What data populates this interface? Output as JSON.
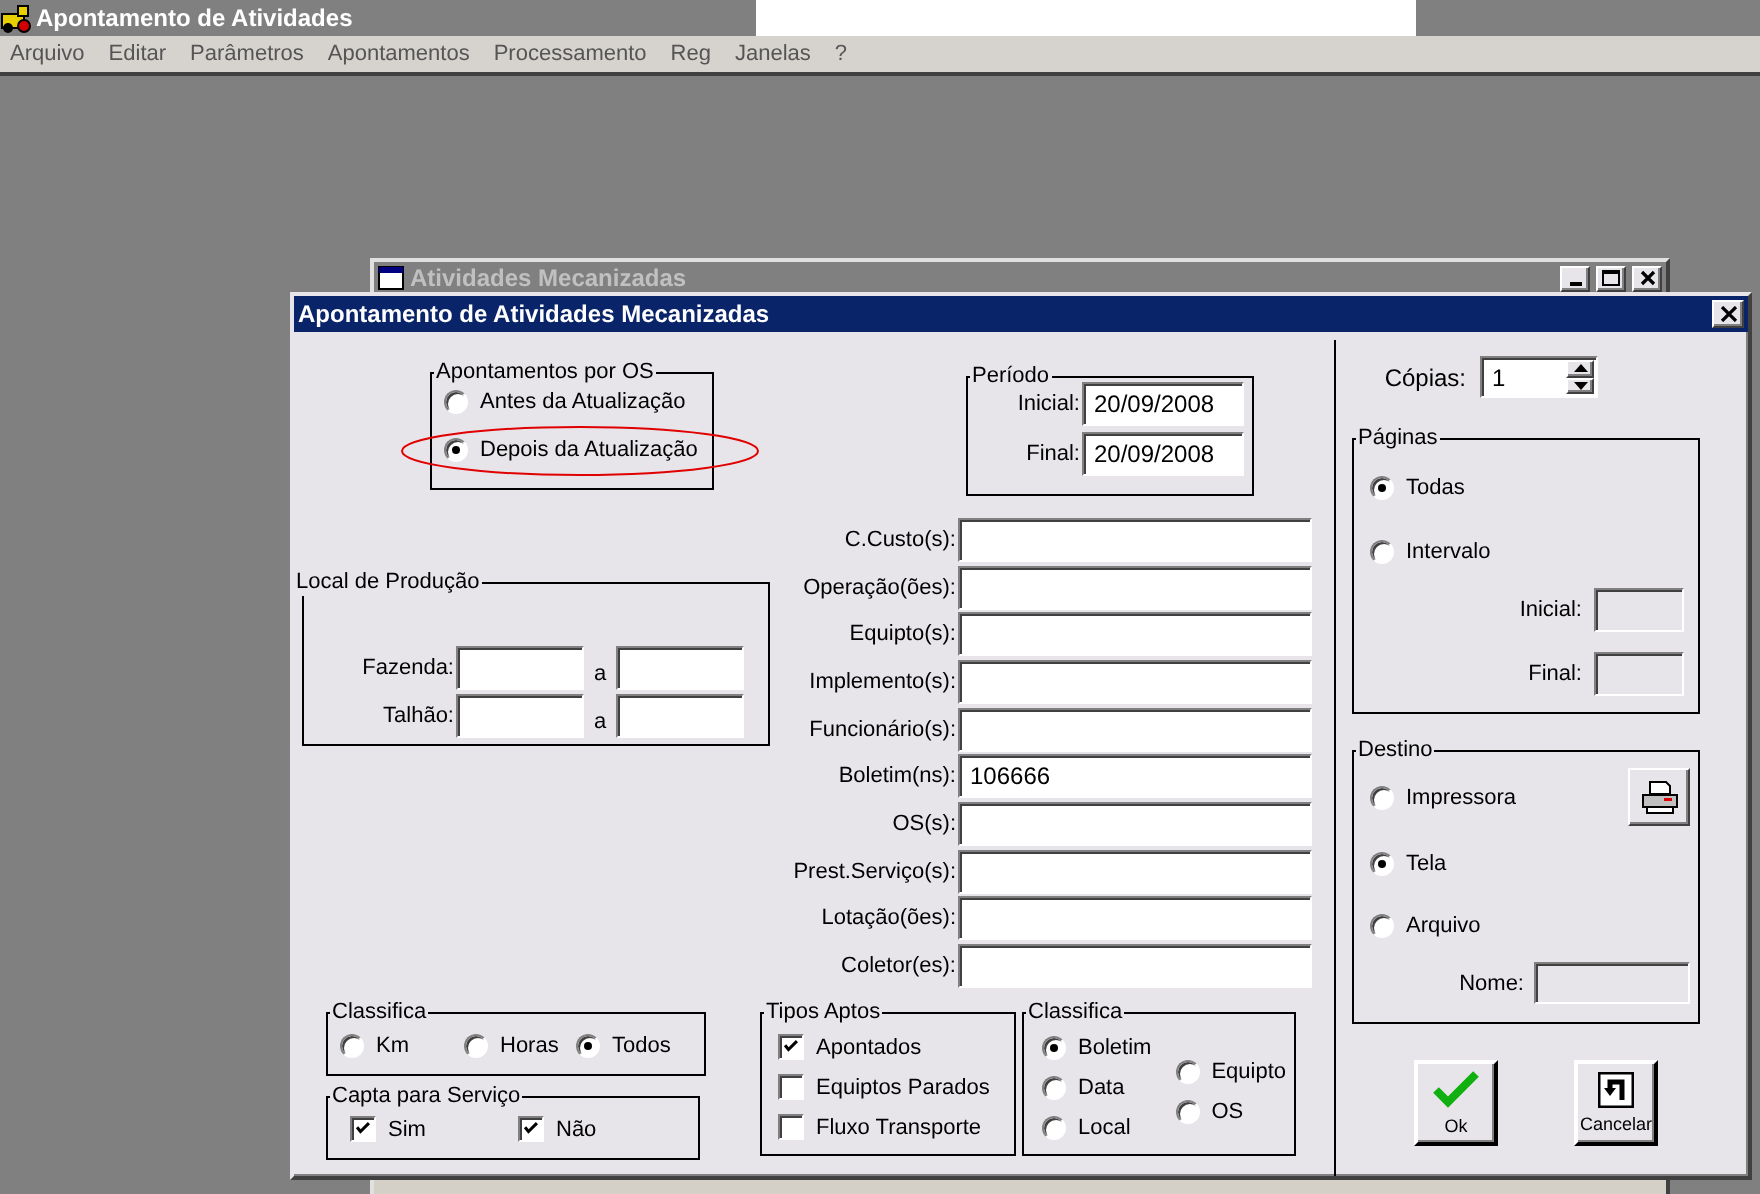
{
  "app": {
    "title": "Apontamento de Atividades",
    "menu": [
      "Arquivo",
      "Editar",
      "Parâmetros",
      "Apontamentos",
      "Processamento",
      "Reg",
      "Janelas",
      "?"
    ]
  },
  "background_window": {
    "title": "Atividades Mecanizadas"
  },
  "dialog": {
    "title": "Apontamento de Atividades Mecanizadas",
    "os_group": {
      "title": "Apontamentos por OS",
      "options": [
        {
          "label": "Antes da Atualização",
          "selected": false,
          "highlighted": false
        },
        {
          "label": "Depois da Atualização",
          "selected": true,
          "highlighted": true
        }
      ]
    },
    "periodo": {
      "title": "Período",
      "fields": [
        {
          "label": "Inicial:",
          "value": "20/09/2008"
        },
        {
          "label": "Final:",
          "value": "20/09/2008"
        }
      ]
    },
    "local": {
      "title": "Local de Produção",
      "rows": [
        {
          "label": "Fazenda:",
          "separator": "a"
        },
        {
          "label": "Talhão:",
          "separator": "a"
        }
      ]
    },
    "filters": [
      {
        "label": "C.Custo(s):"
      },
      {
        "label": "Operação(ões):"
      },
      {
        "label": "Equipto(s):"
      },
      {
        "label": "Implemento(s):"
      },
      {
        "label": "Funcionário(s):"
      },
      {
        "label": "Boletim(ns):",
        "value": "106666"
      },
      {
        "label": "OS(s):"
      },
      {
        "label": "Prest.Serviço(s):"
      },
      {
        "label": "Lotação(ões):"
      },
      {
        "label": "Coletor(es):"
      }
    ],
    "classifica_tipo": {
      "title": "Classifica",
      "options": [
        {
          "label": "Km",
          "selected": false
        },
        {
          "label": "Horas",
          "selected": false
        },
        {
          "label": "Todos",
          "selected": true
        }
      ]
    },
    "capta": {
      "title": "Capta para Serviço",
      "options": [
        {
          "label": "Sim",
          "checked": true
        },
        {
          "label": "Não",
          "checked": true
        }
      ]
    },
    "tipos_aptos": {
      "title": "Tipos Aptos",
      "options": [
        {
          "label": "Apontados",
          "checked": true
        },
        {
          "label": "Equiptos Parados",
          "checked": false
        },
        {
          "label": "Fluxo Transporte",
          "checked": false
        }
      ]
    },
    "classifica_ordem": {
      "title": "Classifica",
      "columns": [
        [
          {
            "label": "Boletim",
            "selected": true
          },
          {
            "label": "Data",
            "selected": false
          },
          {
            "label": "Local",
            "selected": false
          }
        ],
        [
          {
            "label": "Equipto",
            "selected": false
          },
          {
            "label": "OS",
            "selected": false
          }
        ]
      ]
    },
    "copias": {
      "label": "Cópias:",
      "value": "1"
    },
    "paginas": {
      "title": "Páginas",
      "options": [
        {
          "label": "Todas",
          "selected": true
        },
        {
          "label": "Intervalo",
          "selected": false
        }
      ],
      "fields": [
        {
          "label": "Inicial:",
          "disabled": true
        },
        {
          "label": "Final:",
          "disabled": true
        }
      ]
    },
    "destino": {
      "title": "Destino",
      "options": [
        {
          "label": "Impressora",
          "selected": false
        },
        {
          "label": "Tela",
          "selected": true
        },
        {
          "label": "Arquivo",
          "selected": false
        }
      ],
      "name_field": {
        "label": "Nome:",
        "disabled": true
      }
    },
    "buttons": [
      {
        "label": "Ok",
        "kind": "ok"
      },
      {
        "label": "Cancelar",
        "kind": "cancel"
      }
    ]
  }
}
